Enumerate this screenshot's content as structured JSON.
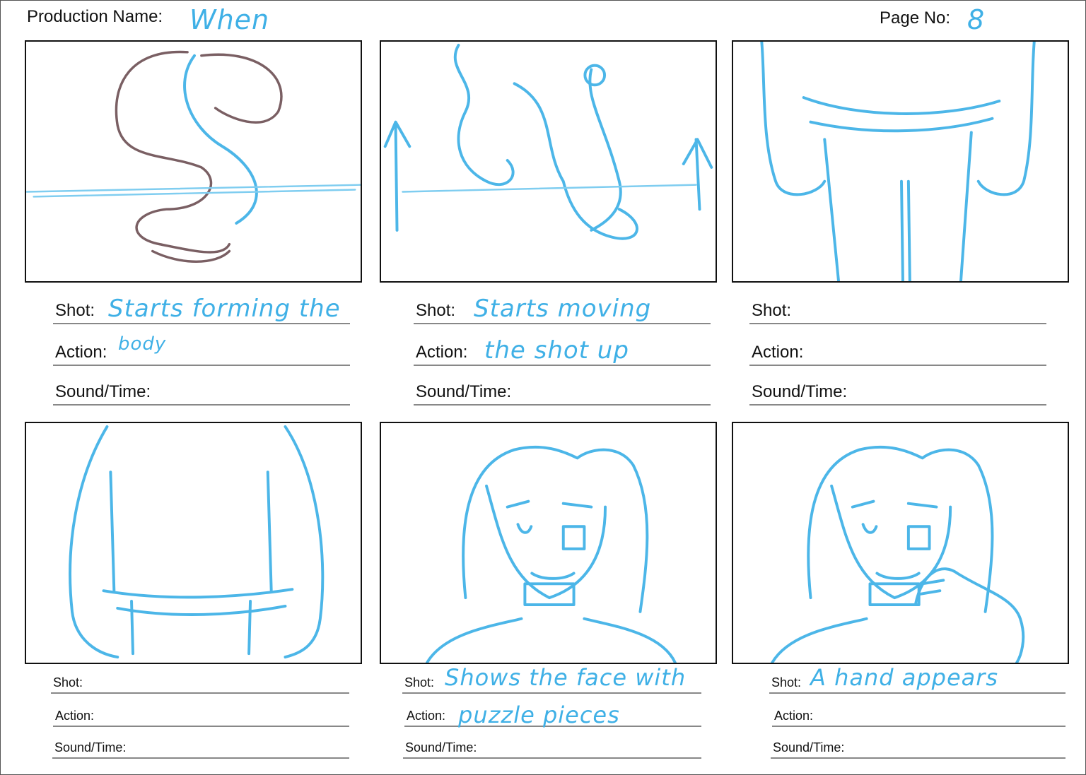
{
  "header": {
    "production_name_label": "Production Name:",
    "production_name_value": "When",
    "page_no_label": "Page No:",
    "page_no_value": "8"
  },
  "field_labels": {
    "shot": "Shot:",
    "action": "Action:",
    "sound_time": "Sound/Time:"
  },
  "panels": [
    {
      "shot": "Starts forming the",
      "action": "body",
      "sound_time": ""
    },
    {
      "shot": "Starts moving",
      "action": "the shot up",
      "sound_time": ""
    },
    {
      "shot": "",
      "action": "",
      "sound_time": ""
    },
    {
      "shot": "",
      "action": "",
      "sound_time": ""
    },
    {
      "shot": "Shows the face with",
      "action": "puzzle pieces",
      "sound_time": ""
    },
    {
      "shot": "A hand appears",
      "action": "",
      "sound_time": ""
    }
  ],
  "colors": {
    "pencil_blue": "#4cb6e8",
    "pencil_brown": "#7a5f63",
    "frame": "#111111",
    "rule": "#888888"
  }
}
